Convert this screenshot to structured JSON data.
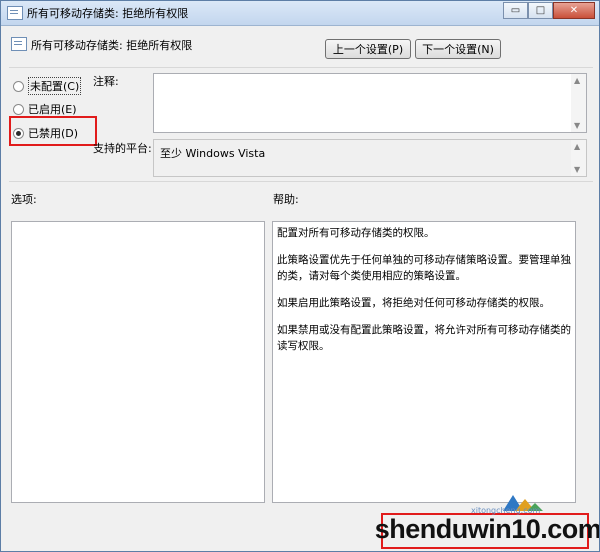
{
  "window": {
    "title": "所有可移动存储类: 拒绝所有权限",
    "controls": {
      "minimize": "▭",
      "maximize": "□",
      "close": "✕"
    }
  },
  "header": {
    "title": "所有可移动存储类: 拒绝所有权限",
    "prev_button": "上一个设置(P)",
    "next_button": "下一个设置(N)"
  },
  "state": {
    "not_configured": "未配置(C)",
    "enabled": "已启用(E)",
    "disabled": "已禁用(D)",
    "selected": "disabled"
  },
  "comment": {
    "label": "注释:",
    "value": ""
  },
  "platform": {
    "label": "支持的平台:",
    "value": "至少 Windows Vista"
  },
  "options": {
    "label": "选项:"
  },
  "help": {
    "label": "帮助:",
    "paragraphs": [
      "配置对所有可移动存储类的权限。",
      "此策略设置优先于任何单独的可移动存储策略设置。要管理单独的类，请对每个类使用相应的策略设置。",
      "如果启用此策略设置，将拒绝对任何可移动存储类的权限。",
      "如果禁用或没有配置此策略设置，将允许对所有可移动存储类的读写权限。"
    ]
  },
  "watermark": {
    "text": "shenduwin10.com",
    "sub": "xitongcheng.com"
  },
  "colors": {
    "highlight": "#e11b1b",
    "window_bg": "#f0f0f0",
    "title_bg": "#c3d6ee"
  }
}
